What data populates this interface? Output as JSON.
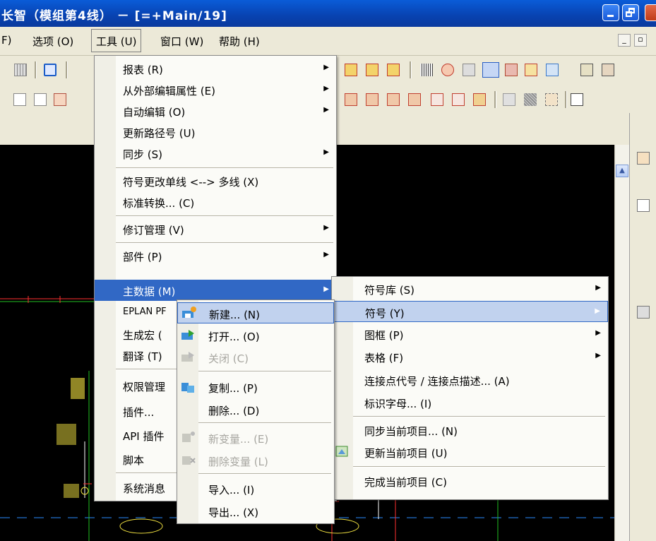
{
  "window": {
    "title": "长智（模组第4线） － [=+Main/19]"
  },
  "menubar": {
    "items": [
      {
        "label": "F)"
      },
      {
        "label": "选项 (O)"
      },
      {
        "label": "工具 (U)"
      },
      {
        "label": "窗口 (W)"
      },
      {
        "label": "帮助 (H)"
      }
    ]
  },
  "tools_menu": {
    "items": [
      {
        "label": "报表 (R)",
        "submenu": true
      },
      {
        "label": "从外部编辑属性 (E)",
        "submenu": true
      },
      {
        "label": "自动编辑 (O)",
        "submenu": true
      },
      {
        "label": "更新路径号 (U)",
        "submenu": false
      },
      {
        "label": "同步 (S)",
        "submenu": true
      },
      {
        "label": "符号更改单线 <--> 多线 (X)",
        "submenu": false
      },
      {
        "label": "标准转换... (C)",
        "submenu": false
      },
      {
        "label": "修订管理 (V)",
        "submenu": true
      },
      {
        "label": "部件 (P)",
        "submenu": true
      },
      {
        "label": "主数据 (M)",
        "submenu": true
      },
      {
        "label": "EPLAN PF",
        "submenu": false
      },
      {
        "label": "生成宏 (",
        "submenu": false
      },
      {
        "label": "翻译 (T)",
        "submenu": false
      },
      {
        "label": "权限管理",
        "submenu": false
      },
      {
        "label": "插件...",
        "submenu": false
      },
      {
        "label": "API 插件",
        "submenu": false
      },
      {
        "label": "脚本",
        "submenu": false
      },
      {
        "label": "系统消息",
        "submenu": false
      }
    ]
  },
  "master_data_menu": {
    "items": [
      {
        "label": "符号库 (S)",
        "submenu": true,
        "icon": ""
      },
      {
        "label": "符号 (Y)",
        "submenu": true,
        "icon": ""
      },
      {
        "label": "图框 (P)",
        "submenu": true,
        "icon": ""
      },
      {
        "label": "表格 (F)",
        "submenu": true,
        "icon": ""
      },
      {
        "label": "连接点代号 / 连接点描述... (A)",
        "submenu": false,
        "icon": ""
      },
      {
        "label": "标识字母... (I)",
        "submenu": false,
        "icon": ""
      },
      {
        "label": "同步当前项目... (N)",
        "submenu": false,
        "icon": ""
      },
      {
        "label": "更新当前项目 (U)",
        "submenu": false,
        "icon": "update-project-icon"
      },
      {
        "label": "完成当前项目 (C)",
        "submenu": false,
        "icon": ""
      }
    ]
  },
  "symbol_menu": {
    "items": [
      {
        "label": "新建... (N)",
        "disabled": false,
        "icon": "new-symbol-icon"
      },
      {
        "label": "打开... (O)",
        "disabled": false,
        "icon": "open-symbol-icon"
      },
      {
        "label": "关闭 (C)",
        "disabled": true,
        "icon": "close-symbol-icon"
      },
      {
        "label": "复制... (P)",
        "disabled": false,
        "icon": "copy-symbol-icon"
      },
      {
        "label": "删除... (D)",
        "disabled": false,
        "icon": ""
      },
      {
        "label": "新变量... (E)",
        "disabled": true,
        "icon": "new-variant-icon"
      },
      {
        "label": "删除变量 (L)",
        "disabled": true,
        "icon": "delete-variant-icon"
      },
      {
        "label": "导入... (I)",
        "disabled": false,
        "icon": ""
      },
      {
        "label": "导出... (X)",
        "disabled": false,
        "icon": ""
      }
    ]
  },
  "colors": {
    "titlebar": "#0a4cc4",
    "highlight": "#3168c5",
    "canvas": "#000000",
    "wire_red": "#ff3030",
    "wire_green": "#22c022",
    "wire_yellow": "#f0e040"
  }
}
